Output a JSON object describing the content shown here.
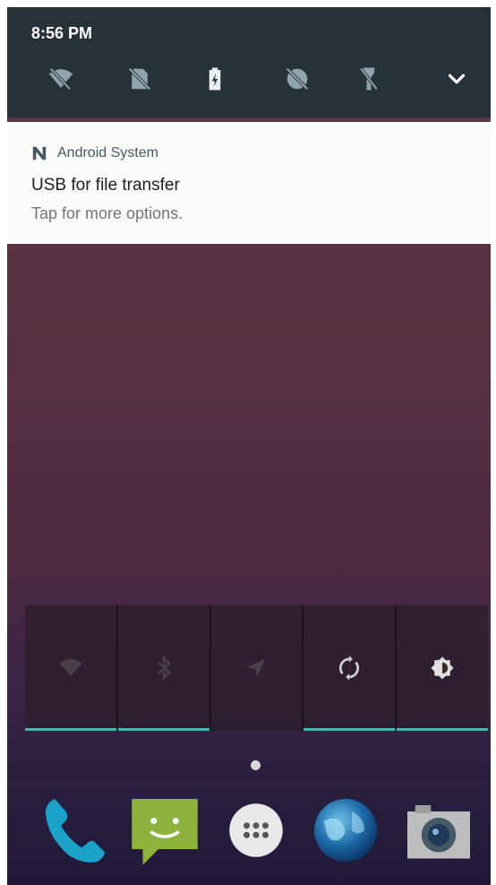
{
  "status_bar": {
    "time": "8:56 PM"
  },
  "quick_settings_header": {
    "icons": [
      "wifi-off-icon",
      "no-sim-icon",
      "battery-charging-icon",
      "data-saver-off-icon",
      "flashlight-off-icon",
      "expand-chevron-icon"
    ]
  },
  "notification": {
    "app_name": "Android System",
    "title": "USB for file transfer",
    "text": "Tap for more options."
  },
  "tiles": [
    {
      "icon": "wifi-icon",
      "active": true
    },
    {
      "icon": "bluetooth-icon",
      "active": true
    },
    {
      "icon": "location-icon",
      "active": false
    },
    {
      "icon": "auto-rotate-icon",
      "active": true
    },
    {
      "icon": "brightness-icon",
      "active": true
    }
  ],
  "dock": {
    "apps": [
      "phone-icon",
      "messaging-icon",
      "app-drawer-icon",
      "browser-icon",
      "camera-icon"
    ]
  },
  "colors": {
    "header_bg": "#263238",
    "accent_teal": "#4db6ac"
  }
}
